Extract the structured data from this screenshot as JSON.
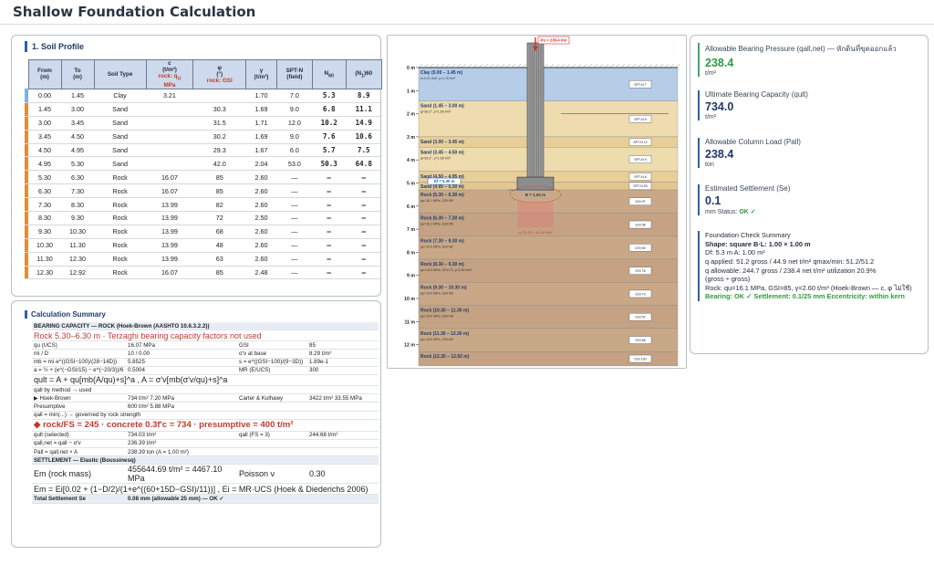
{
  "page": {
    "title": "Shallow Foundation Calculation"
  },
  "soil": {
    "heading": "1. Soil Profile",
    "headers": {
      "from": "From\n(m)",
      "to": "To\n(m)",
      "type": "Soil Type",
      "c": "c\n(t/m²)",
      "c_rock": "rock: q",
      "c_sub": "U",
      "c_unit": "MPa",
      "phi": "φ\n(°)",
      "phi_rock": "rock: GSI",
      "gamma": "γ\n(t/m³)",
      "sptn": "SPT-N\n(field)",
      "n60": "N",
      "n60_sub": "60",
      "n160": "(N",
      "n160_sub": "1",
      "n160_tail": ")60"
    },
    "rows": [
      {
        "from": "0.00",
        "to": "1.45",
        "type": "Clay",
        "c": "3.21",
        "phi": "",
        "gamma": "1.70",
        "spt": "7.0",
        "n60": "5.3",
        "n160": "8.9",
        "color": "#7fb0df"
      },
      {
        "from": "1.45",
        "to": "3.00",
        "type": "Sand",
        "c": "",
        "phi": "30.3",
        "gamma": "1.69",
        "spt": "9.0",
        "n60": "6.8",
        "n160": "11.1",
        "color": "#e98a35"
      },
      {
        "from": "3.00",
        "to": "3.45",
        "type": "Sand",
        "c": "",
        "phi": "31.5",
        "gamma": "1.71",
        "spt": "12.0",
        "n60": "10.2",
        "n160": "14.9",
        "color": "#e98a35"
      },
      {
        "from": "3.45",
        "to": "4.50",
        "type": "Sand",
        "c": "",
        "phi": "30.2",
        "gamma": "1.69",
        "spt": "9.0",
        "n60": "7.6",
        "n160": "10.6",
        "color": "#e98a35"
      },
      {
        "from": "4.50",
        "to": "4.95",
        "type": "Sand",
        "c": "",
        "phi": "29.3",
        "gamma": "1.67",
        "spt": "6.0",
        "n60": "5.7",
        "n160": "7.5",
        "color": "#e98a35"
      },
      {
        "from": "4.95",
        "to": "5.30",
        "type": "Sand",
        "c": "",
        "phi": "42.0",
        "gamma": "2.04",
        "spt": "53.0",
        "n60": "50.3",
        "n160": "64.8",
        "color": "#e98a35"
      },
      {
        "from": "5.30",
        "to": "6.30",
        "type": "Rock",
        "c": "16.07",
        "phi": "85",
        "gamma": "2.60",
        "spt": "—",
        "n60": "—",
        "n160": "—",
        "color": "#e98a35"
      },
      {
        "from": "6.30",
        "to": "7.30",
        "type": "Rock",
        "c": "16.07",
        "phi": "85",
        "gamma": "2.60",
        "spt": "—",
        "n60": "—",
        "n160": "—",
        "color": "#e98a35"
      },
      {
        "from": "7.30",
        "to": "8.30",
        "type": "Rock",
        "c": "13.99",
        "phi": "82",
        "gamma": "2.60",
        "spt": "—",
        "n60": "—",
        "n160": "—",
        "color": "#e98a35"
      },
      {
        "from": "8.30",
        "to": "9.30",
        "type": "Rock",
        "c": "13.99",
        "phi": "72",
        "gamma": "2.50",
        "spt": "—",
        "n60": "—",
        "n160": "—",
        "color": "#e98a35"
      },
      {
        "from": "9.30",
        "to": "10.30",
        "type": "Rock",
        "c": "13.99",
        "phi": "68",
        "gamma": "2.60",
        "spt": "—",
        "n60": "—",
        "n160": "—",
        "color": "#e98a35"
      },
      {
        "from": "10.30",
        "to": "11.30",
        "type": "Rock",
        "c": "13.99",
        "phi": "48",
        "gamma": "2.60",
        "spt": "—",
        "n60": "—",
        "n160": "—",
        "color": "#e98a35"
      },
      {
        "from": "11.30",
        "to": "12.30",
        "type": "Rock",
        "c": "13.99",
        "phi": "63",
        "gamma": "2.60",
        "spt": "—",
        "n60": "—",
        "n160": "—",
        "color": "#e98a35"
      },
      {
        "from": "12.30",
        "to": "12.92",
        "type": "Rock",
        "c": "16.07",
        "phi": "85",
        "gamma": "2.48",
        "spt": "—",
        "n60": "—",
        "n160": "—",
        "color": "#e98a35"
      }
    ]
  },
  "calc": {
    "heading": "Calculation Summary",
    "rows": [
      {
        "cls": "band",
        "a": "BEARING CAPACITY — ROCK (Hoek-Brown (AASHTO 10.6.3.2.2))",
        "b": "",
        "c": "",
        "d": ""
      },
      {
        "cls": "red big",
        "a": "Rock 5.30–6.30 m  ·  Terzaghi bearing capacity factors not used",
        "b": "",
        "c": "",
        "d": ""
      },
      {
        "cls": "",
        "a": "qu (UCS)",
        "b": "16.07 MPa",
        "c": "GSI",
        "d": "85"
      },
      {
        "cls": "",
        "a": "mi / D",
        "b": "10 / 0.00",
        "c": "σ'v at base",
        "d": "8.29 t/m²"
      },
      {
        "cls": "",
        "a": "mb = mi·e^((GSI−100)/(28−14D))",
        "b": "5.8525",
        "c": "s = e^((GSI−100)/(9−3D))",
        "d": "1.89e-1"
      },
      {
        "cls": "",
        "a": "a = ½ + (e^(−GSI/15) − e^(−20/3))/6",
        "b": "0.5004",
        "c": "MR (E/UCS)",
        "d": "300"
      },
      {
        "cls": "big",
        "a": "qult = A + qu[mb(A/qu)+s]^a ,  A = σ'v[mb(σ'v/qu)+s]^a",
        "b": "",
        "c": "",
        "d": ""
      },
      {
        "cls": "",
        "a": "qall by method → used",
        "b": "",
        "c": "",
        "d": ""
      },
      {
        "cls": "",
        "a": "▶ Hoek-Brown",
        "b": "734 t/m² 7.20 MPa",
        "c": "Carter & Kulhawy",
        "d": "3422 t/m² 33.55 MPa"
      },
      {
        "cls": "",
        "a": "Presumptive",
        "b": "600 t/m² 5.88 MPa",
        "c": "",
        "d": ""
      },
      {
        "cls": "",
        "a": "qall = min(...) → governed by rock strength",
        "b": "",
        "c": "",
        "d": ""
      },
      {
        "cls": "bigr red",
        "a": "◆ rock/FS = 245  ·  concrete 0.3f'c = 734  ·  presumptive = 400  t/m²",
        "b": "",
        "c": "",
        "d": ""
      },
      {
        "cls": "",
        "a": "qult (selected)",
        "b": "734.03 t/m²",
        "c": "qall (FS = 3)",
        "d": "244.68 t/m²"
      },
      {
        "cls": "",
        "a": "qall,net = qall − σ'v",
        "b": "236.39 t/m²",
        "c": "",
        "d": ""
      },
      {
        "cls": "",
        "a": "Pall = qall,net × A",
        "b": "238.39 ton  (A = 1.00 m²)",
        "c": "",
        "d": ""
      },
      {
        "cls": "band",
        "a": "SETTLEMENT — Elastic (Boussinesq)",
        "b": "",
        "c": "",
        "d": ""
      },
      {
        "cls": "big",
        "a": "Em (rock mass)",
        "b": "455644.69 t/m² = 4467.10 MPa",
        "c": "Poisson ν",
        "d": "0.30"
      },
      {
        "cls": "big",
        "a": "Em = Ei[0.02 + (1−D/2)/(1+e^((60+15D−GSI)/11))] ,  Ei = MR·UCS  (Hoek & Diederichs 2006)",
        "b": "",
        "c": "",
        "d": ""
      },
      {
        "cls": "band",
        "a": "Total Settlement Se",
        "b": "0.08 mm  (allowable 25 mm) — OK ✓",
        "c": "",
        "d": ""
      }
    ]
  },
  "diagram": {
    "load_label": "Pu = 238.4 ton",
    "df_label": "Df = 5.30 m",
    "b_label": "B = 1.00 m",
    "q_label": "q, 51.20 – 51.20 t/m²",
    "depths": [
      "0 m",
      "1 m",
      "2 m",
      "3 m",
      "4 m",
      "5 m",
      "6 m",
      "7 m",
      "8 m",
      "9 m",
      "10 m",
      "11 m",
      "12 m"
    ],
    "layers": [
      {
        "name": "Clay (0.00 – 1.45 m)",
        "sub": "c=3.21 t/m², γ=1.70 t/m³",
        "tag": "SPT-N 7"
      },
      {
        "name": "Sand (1.45 – 3.00 m)",
        "sub": "φ=30.3°, γ=1.69 t/m³",
        "tag": "SPT-N 9"
      },
      {
        "name": "Sand (3.00 – 3.45 m)",
        "sub": "",
        "tag": "SPT-N 12"
      },
      {
        "name": "Sand (3.45 – 4.50 m)",
        "sub": "φ=30.2°, γ=1.69 t/m³",
        "tag": "SPT-N 9"
      },
      {
        "name": "Sand (4.50 – 4.95 m)",
        "sub": "",
        "tag": "SPT-N 6"
      },
      {
        "name": "Sand (4.95 – 5.30 m)",
        "sub": "",
        "tag": "SPT-N 53"
      },
      {
        "name": "Rock (5.30 – 6.30 m)",
        "sub": "qu=16.1 MPa, GSI=85",
        "tag": "GSI 97"
      },
      {
        "name": "Rock (6.30 – 7.30 m)",
        "sub": "qu=16.1 MPa, GSI=85",
        "tag": "GSI 98"
      },
      {
        "name": "Rock (7.30 – 8.30 m)",
        "sub": "qu=14.0 MPa, GSI=82",
        "tag": "GSI 90"
      },
      {
        "name": "Rock (8.30 – 9.30 m)",
        "sub": "qu=14.0 MPa, GSI=72, γ=2.50 t/m³",
        "tag": "GSI 78"
      },
      {
        "name": "Rock (9.30 – 10.30 m)",
        "sub": "qu=14.0 MPa, GSI=68",
        "tag": "GSI 73"
      },
      {
        "name": "Rock (10.30 – 11.30 m)",
        "sub": "qu=14.0 MPa, GSI=48",
        "tag": "GSI 57"
      },
      {
        "name": "Rock (11.30 – 12.30 m)",
        "sub": "qu=14.0 MPa, GSI=63",
        "tag": "GSI 68"
      },
      {
        "name": "Rock (12.30 – 12.92 m)",
        "sub": "",
        "tag": "GSI 100"
      }
    ]
  },
  "results": {
    "abp": {
      "label": "Allowable Bearing Pressure (qall,net) — หักดินที่ขุดออกแล้ว",
      "value": "238.4",
      "unit": "t/m²"
    },
    "ubc": {
      "label": "Ultimate Bearing Capacity (qult)",
      "value": "734.0",
      "unit": "t/m²"
    },
    "acl": {
      "label": "Allowable Column Load (Pall)",
      "value": "238.4",
      "unit": "ton"
    },
    "es": {
      "label": "Estimated Settlement (Se)",
      "value": "0.1",
      "unit": "mm Status: ",
      "status": "OK ✓"
    },
    "check": {
      "label": "Foundation Check Summary",
      "l1": "Shape: square  B·L: 1.00 × 1.00 m",
      "l2": "Df: 5.3 m   A: 1.00 m²",
      "l3": "q applied: 51.2 gross / 44.9 net t/m²  qmax/min: 51.2/51.2",
      "l4": "q allowable: 244.7 gross / 238.4 net t/m²  utilization 20.9%",
      "l5": "(gross ÷ gross)",
      "l6": "Rock: qu=16.1 MPa, GSI=85, γ=2.60 t/m³ (Hoek-Brown — c, φ ไม่ใช้)",
      "l7": "Bearing: OK ✓  Settlement: 0.1/25 mm  Eccentricity: within kern"
    }
  }
}
